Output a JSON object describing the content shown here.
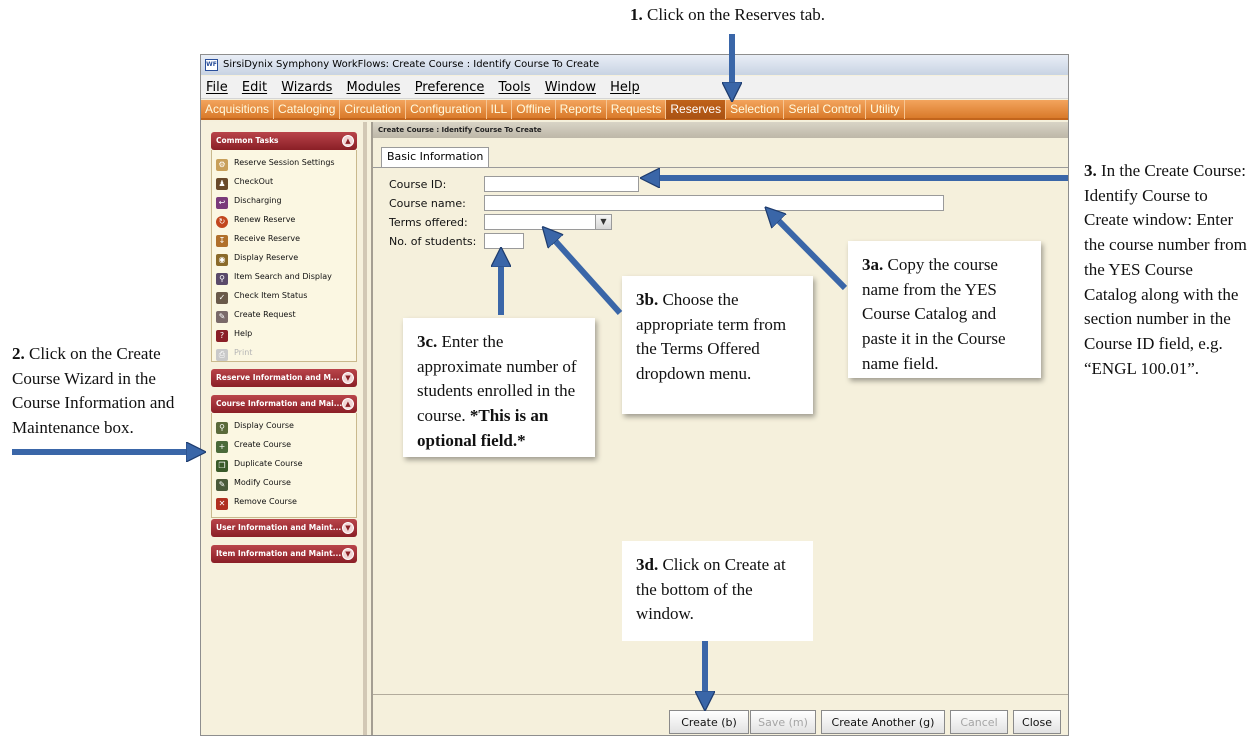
{
  "window": {
    "icon_text": "WF",
    "title": "SirsiDynix Symphony WorkFlows: Create Course : Identify Course To Create"
  },
  "menu": [
    "File",
    "Edit",
    "Wizards",
    "Modules",
    "Preference",
    "Tools",
    "Window",
    "Help"
  ],
  "modules": [
    "Acquisitions",
    "Cataloging",
    "Circulation",
    "Configuration",
    "ILL",
    "Offline",
    "Reports",
    "Requests",
    "Reserves",
    "Selection",
    "Serial Control",
    "Utility"
  ],
  "active_module": "Reserves",
  "left_panel": {
    "common_tasks": {
      "title": "Common Tasks",
      "items": [
        "Reserve Session Settings",
        "CheckOut",
        "Discharging",
        "Renew Reserve",
        "Receive Reserve",
        "Display Reserve",
        "Item Search and Display",
        "Check Item Status",
        "Create Request",
        "Help",
        "Print"
      ]
    },
    "reserve_info": {
      "title": "Reserve Information and M..."
    },
    "course_info": {
      "title": "Course Information and Mai...",
      "items": [
        "Display Course",
        "Create Course",
        "Duplicate Course",
        "Modify Course",
        "Remove Course"
      ]
    },
    "user_info": {
      "title": "User Information and Maint..."
    },
    "item_info": {
      "title": "Item Information and Maint..."
    }
  },
  "workspace": {
    "header": "Create Course : Identify Course To Create",
    "tab": "Basic Information",
    "fields": {
      "course_id": {
        "label": "Course ID:",
        "value": ""
      },
      "course_name": {
        "label": "Course name:",
        "value": ""
      },
      "terms_offered": {
        "label": "Terms offered:",
        "value": ""
      },
      "num_students": {
        "label": "No. of students:",
        "value": ""
      }
    },
    "buttons": {
      "create": "Create (b)",
      "save": "Save (m)",
      "create_another": "Create Another (g)",
      "cancel": "Cancel",
      "close": "Close"
    }
  },
  "annotations": {
    "step1": {
      "num": "1.",
      "text": "Click on the Reserves tab."
    },
    "step2": {
      "num": "2.",
      "text": "Click on the Create Course Wizard in the Course Information and Maintenance box."
    },
    "step3": {
      "num": "3.",
      "text": "In the Create Course: Identify Course to Create window: Enter the course number from the YES Course Catalog along with the section number in the Course ID field, e.g. “ENGL 100.01”."
    },
    "step3a": {
      "num": "3a.",
      "text": "Copy the course name from the YES Course Catalog and paste it in the Course name field."
    },
    "step3b": {
      "num": "3b.",
      "text": "Choose the appropriate term from the Terms Offered dropdown menu."
    },
    "step3c": {
      "num": "3c.",
      "text": "Enter the approximate number of students enrolled in the course.",
      "bold": "*This is an optional field.*"
    },
    "step3d": {
      "num": "3d.",
      "text": "Click on Create at the bottom of the window."
    }
  },
  "colors": {
    "module_bar": "#e08a3c",
    "box_header": "#a0323a",
    "arrow": "#3a66a8",
    "workspace_bg": "#f5f0dc"
  }
}
